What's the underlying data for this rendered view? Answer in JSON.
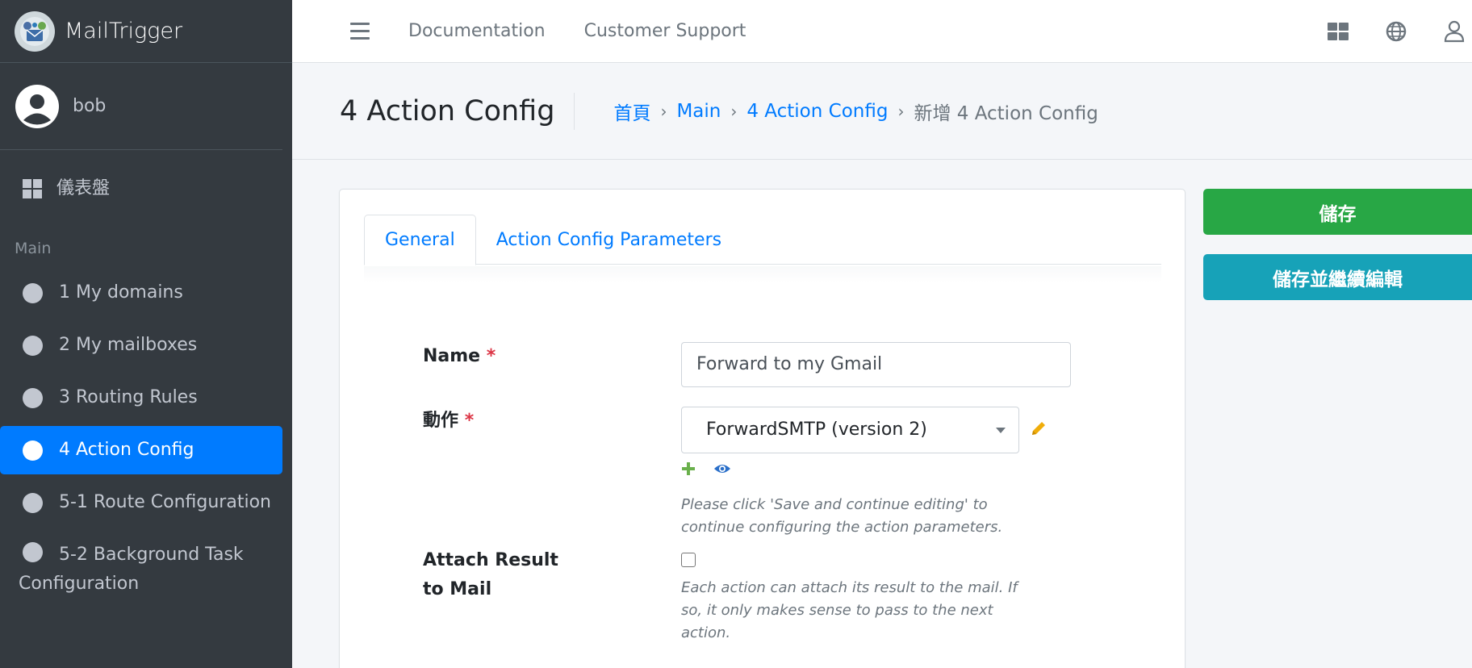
{
  "brand": {
    "name": "MailTrigger"
  },
  "user": {
    "name": "bob"
  },
  "sidebar": {
    "dashboard": "儀表盤",
    "section_header": "Main",
    "items": [
      {
        "label": "1 My domains",
        "active": false
      },
      {
        "label": "2 My mailboxes",
        "active": false
      },
      {
        "label": "3 Routing Rules",
        "active": false
      },
      {
        "label": "4 Action Config",
        "active": true
      },
      {
        "label": "5-1 Route Configuration",
        "active": false
      },
      {
        "label": "5-2 Background Task Configuration",
        "active": false
      }
    ]
  },
  "topbar": {
    "links": [
      "Documentation",
      "Customer Support"
    ],
    "icons": [
      "menu-icon",
      "apps-grid-icon",
      "globe-icon",
      "user-icon"
    ]
  },
  "header": {
    "title": "4 Action Config",
    "breadcrumb": [
      "首頁",
      "Main",
      "4 Action Config",
      "新增 4 Action Config"
    ]
  },
  "tabs": [
    "General",
    "Action Config Parameters"
  ],
  "form": {
    "name_label": "Name",
    "name_value": "Forward to my Gmail",
    "action_label": "動作",
    "action_value": "ForwardSMTP (version 2)",
    "action_help": "Please click 'Save and continue editing' to continue configuring the action parameters.",
    "attach_label": "Attach Result to Mail",
    "attach_checked": false,
    "attach_help": "Each action can attach its result to the mail. If so, it only makes sense to pass to the next action.",
    "required_mark": "*"
  },
  "buttons": {
    "save": "儲存",
    "save_continue": "儲存並繼續編輯"
  },
  "colors": {
    "sidebar_bg": "#343a40",
    "active_item": "#007bff",
    "save": "#28a745",
    "save_continue": "#17a2b8",
    "link": "#007bff",
    "required": "#dc3545"
  }
}
